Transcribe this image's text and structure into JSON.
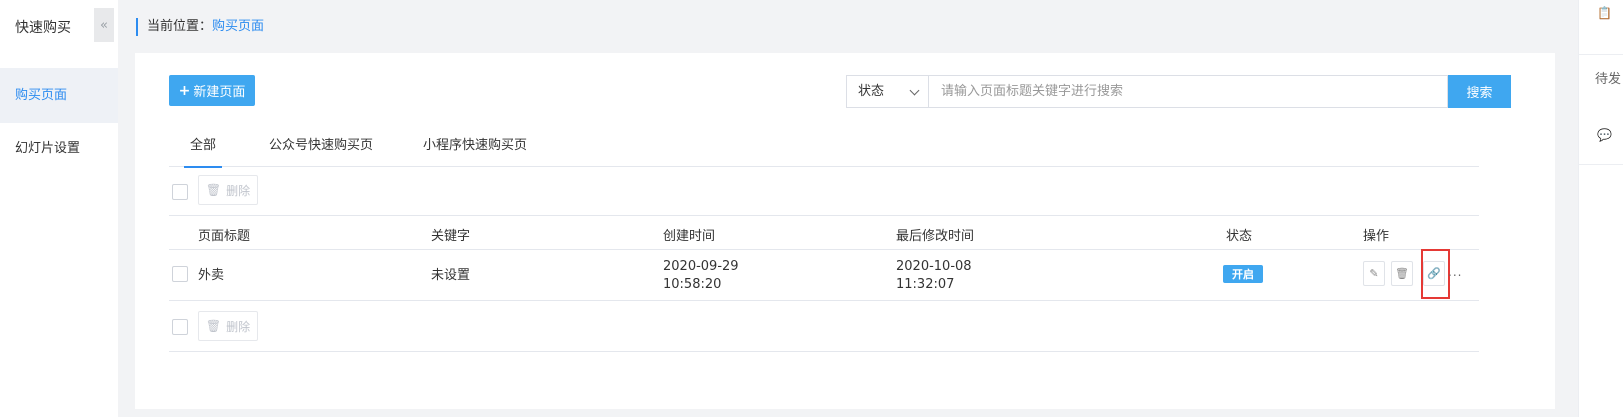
{
  "sidebar": {
    "title": "快速购买",
    "collapse_icon": "«",
    "items": [
      {
        "label": "购买页面",
        "active": true
      },
      {
        "label": "幻灯片设置",
        "active": false
      }
    ]
  },
  "breadcrumb": {
    "prefix": "当前位置：",
    "current": "购买页面"
  },
  "toolbar": {
    "new_button": "新建页面",
    "status_select": "状态",
    "search_placeholder": "请输入页面标题关键字进行搜索",
    "search_button": "搜索"
  },
  "tabs": [
    "全部",
    "公众号快速购买页",
    "小程序快速购买页"
  ],
  "batch": {
    "delete_label": "删除"
  },
  "table": {
    "columns": [
      "页面标题",
      "关键字",
      "创建时间",
      "最后修改时间",
      "状态",
      "操作"
    ],
    "rows": [
      {
        "title": "外卖",
        "keyword": "未设置",
        "created_date": "2020-09-29",
        "created_time": "10:58:20",
        "modified_date": "2020-10-08",
        "modified_time": "11:32:07",
        "status": "开启"
      }
    ],
    "more": "..."
  },
  "right_panel": {
    "label": "待发"
  },
  "colors": {
    "accent": "#3fa7f0",
    "link": "#2d8cf0",
    "highlight": "#e53935"
  }
}
